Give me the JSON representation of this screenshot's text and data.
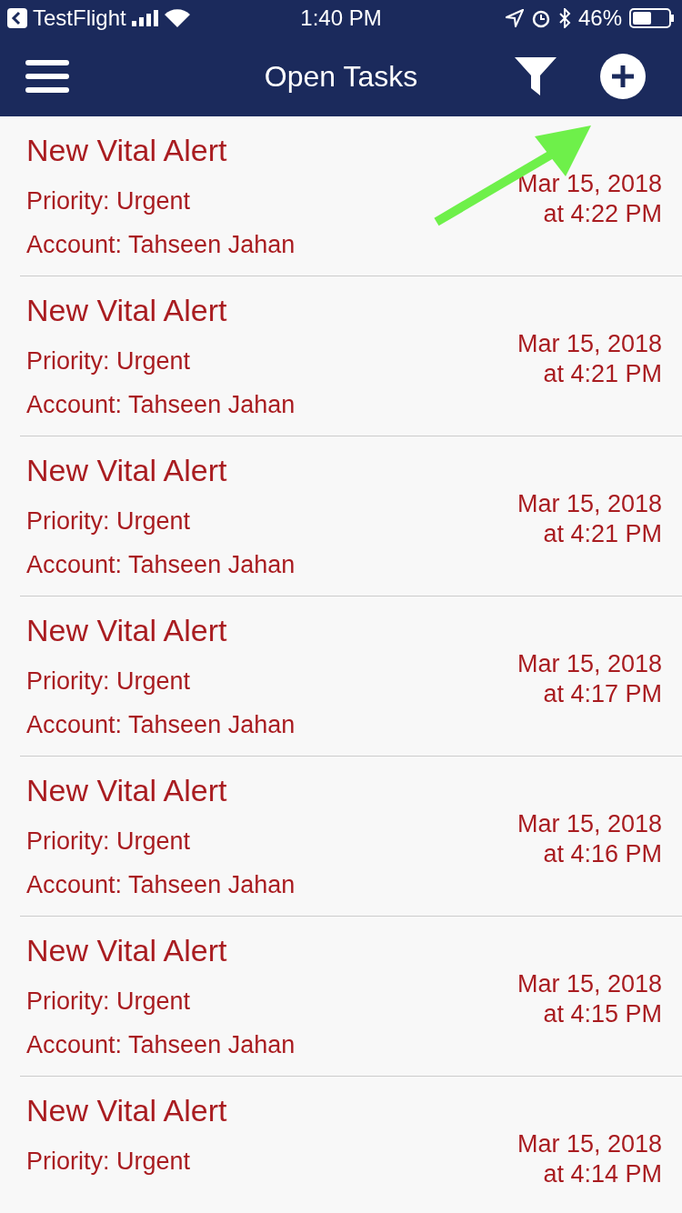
{
  "status_bar": {
    "back_app": "TestFlight",
    "time": "1:40 PM",
    "battery_percent": "46%"
  },
  "nav_bar": {
    "title": "Open Tasks"
  },
  "tasks": [
    {
      "title": "New Vital Alert",
      "priority": "Priority: Urgent",
      "account": "Account: Tahseen Jahan",
      "date": "Mar 15, 2018",
      "time": "at 4:22 PM"
    },
    {
      "title": "New Vital Alert",
      "priority": "Priority: Urgent",
      "account": "Account: Tahseen Jahan",
      "date": "Mar 15, 2018",
      "time": "at 4:21 PM"
    },
    {
      "title": "New Vital Alert",
      "priority": "Priority: Urgent",
      "account": "Account: Tahseen Jahan",
      "date": "Mar 15, 2018",
      "time": "at 4:21 PM"
    },
    {
      "title": "New Vital Alert",
      "priority": "Priority: Urgent",
      "account": "Account: Tahseen Jahan",
      "date": "Mar 15, 2018",
      "time": "at 4:17 PM"
    },
    {
      "title": "New Vital Alert",
      "priority": "Priority: Urgent",
      "account": "Account: Tahseen Jahan",
      "date": "Mar 15, 2018",
      "time": "at 4:16 PM"
    },
    {
      "title": "New Vital Alert",
      "priority": "Priority: Urgent",
      "account": "Account: Tahseen Jahan",
      "date": "Mar 15, 2018",
      "time": "at 4:15 PM"
    },
    {
      "title": "New Vital Alert",
      "priority": "Priority: Urgent",
      "date": "Mar 15, 2018",
      "time": "at 4:14 PM"
    }
  ]
}
